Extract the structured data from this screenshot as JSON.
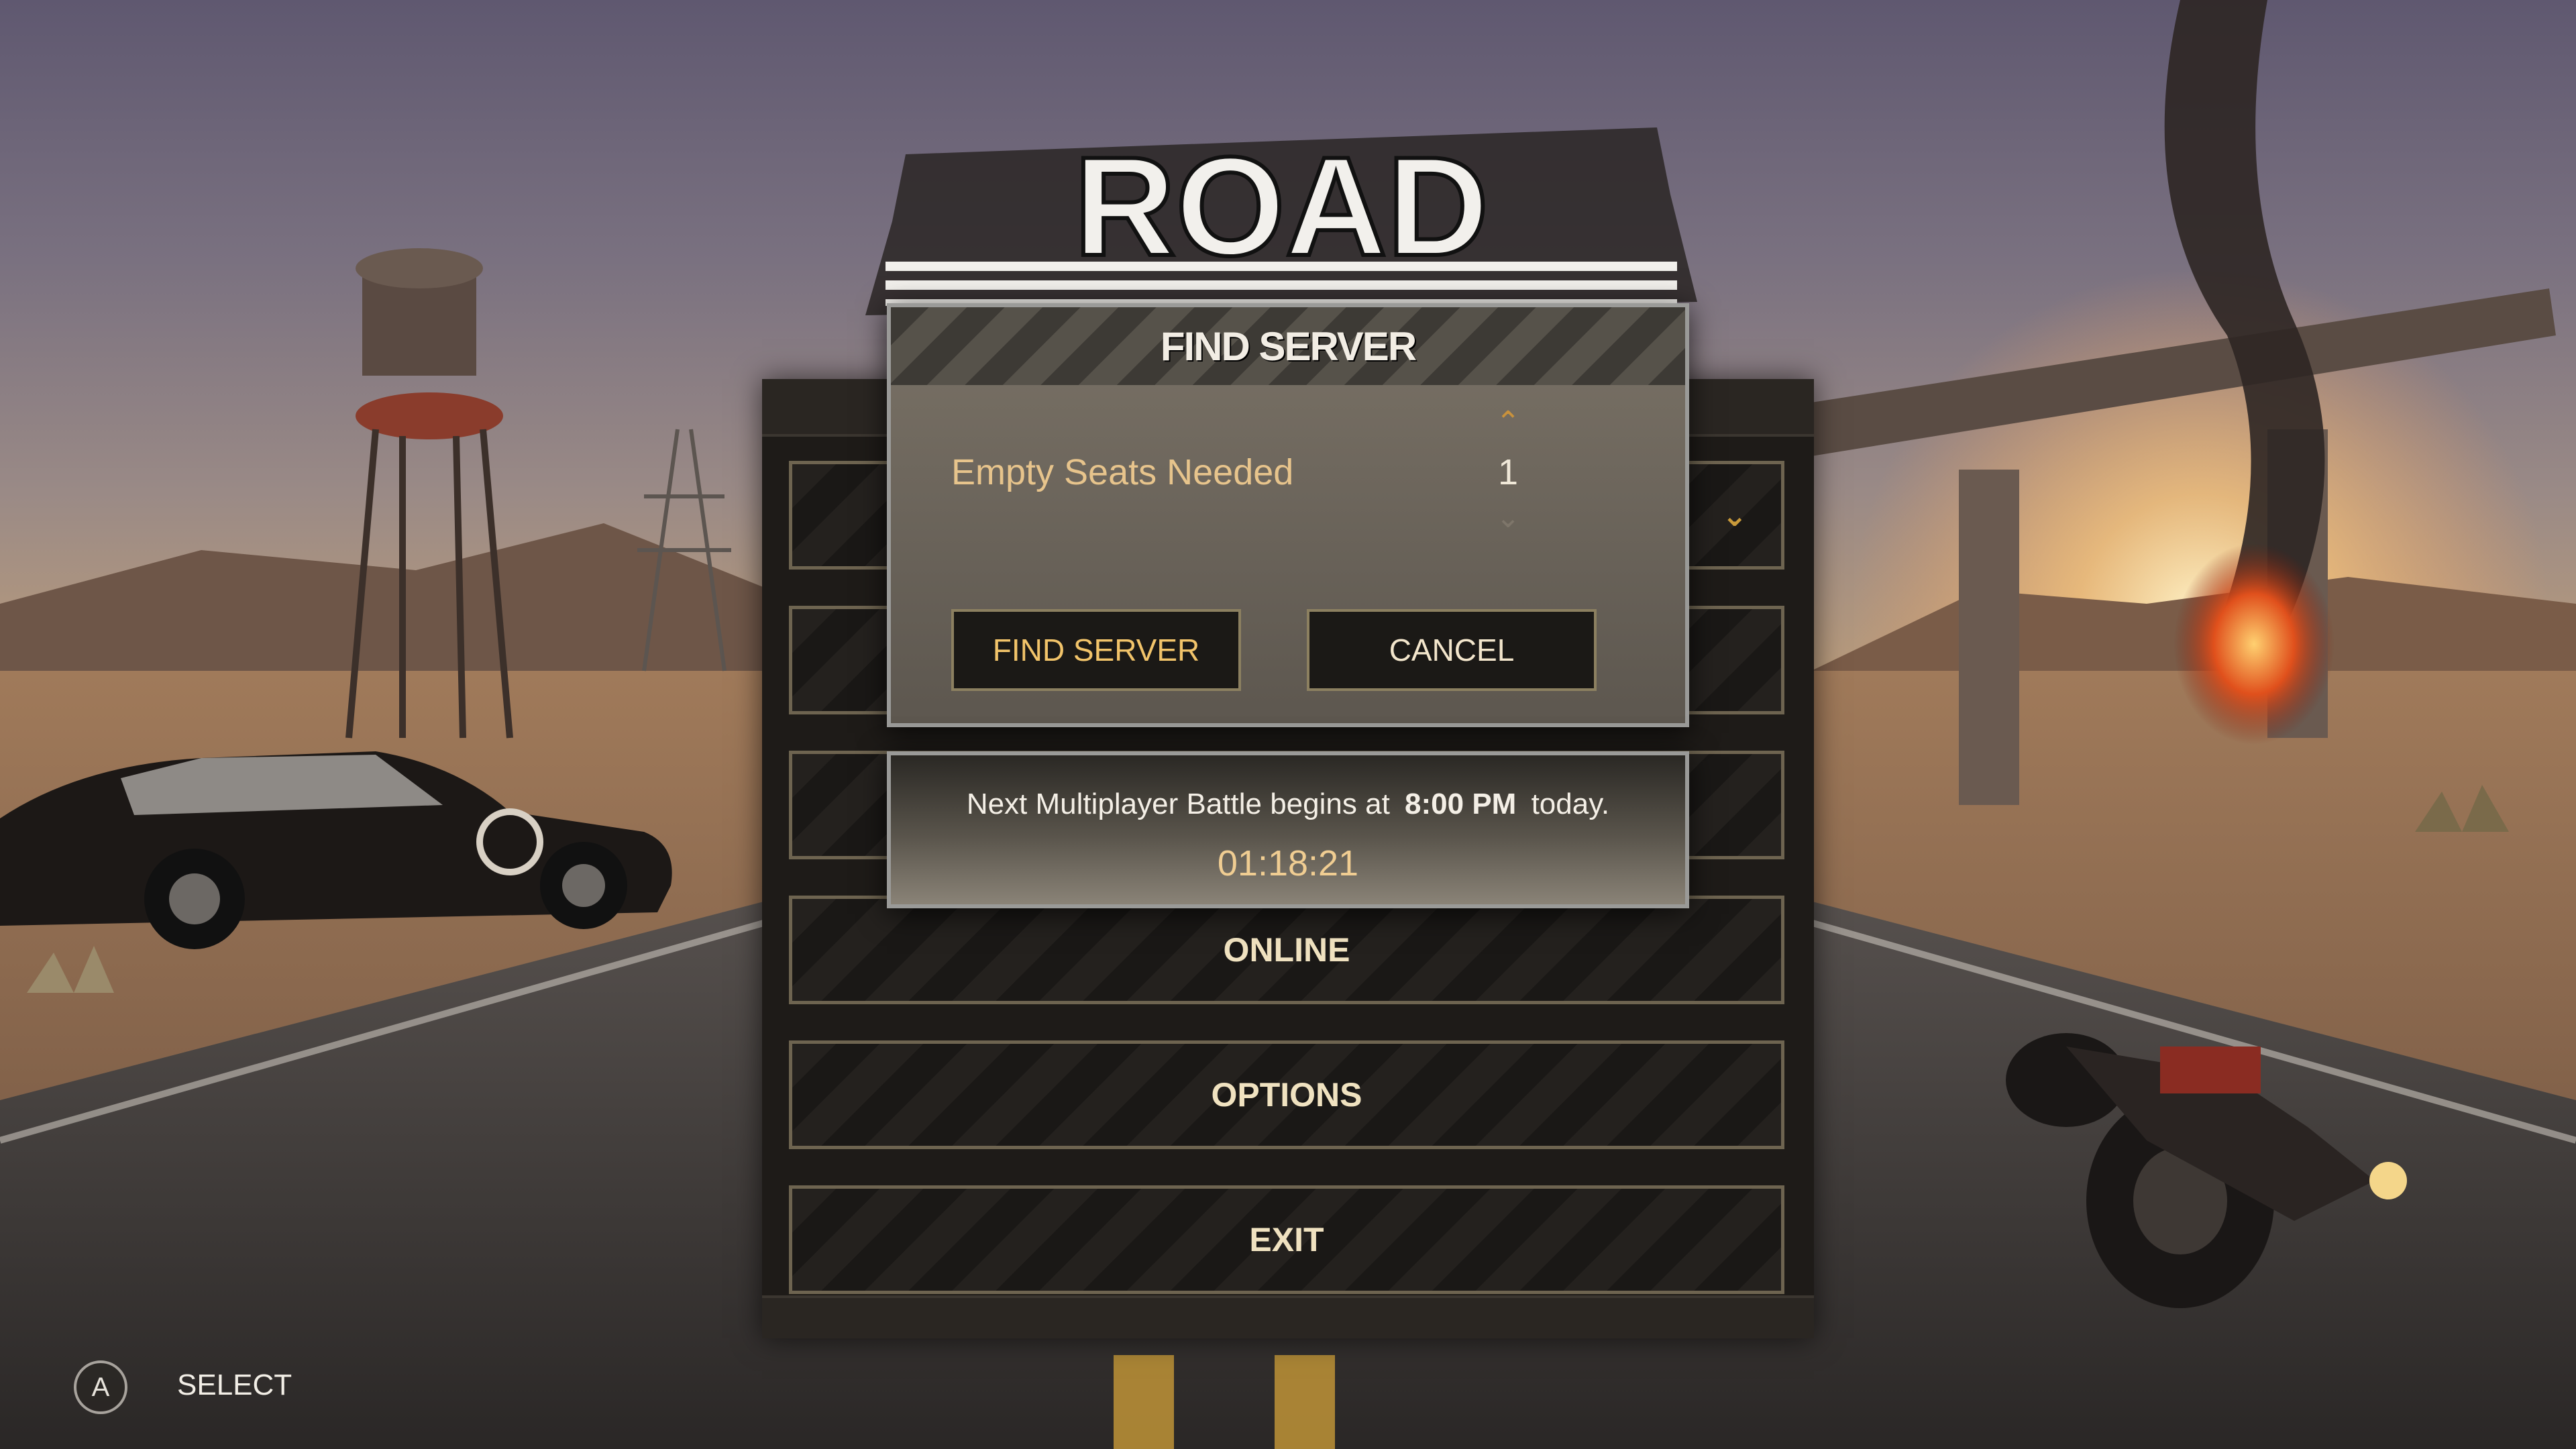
{
  "game": {
    "logo_text": "ROAD"
  },
  "main_menu": {
    "items": [
      {
        "label": ""
      },
      {
        "label": ""
      },
      {
        "label": ""
      },
      {
        "label": "ONLINE"
      },
      {
        "label": "OPTIONS"
      },
      {
        "label": "EXIT"
      }
    ],
    "dropdown_icon": "chevron-down-icon"
  },
  "find_server_dialog": {
    "title": "FIND SERVER",
    "seats_label": "Empty Seats Needed",
    "seats_value": "1",
    "up_icon": "chevron-up-icon",
    "down_icon": "chevron-down-icon",
    "find_button": "FIND SERVER",
    "cancel_button": "CANCEL"
  },
  "next_battle": {
    "prefix": "Next Multiplayer Battle begins at",
    "time": "8:00 PM",
    "suffix": "today.",
    "countdown": "01:18:21"
  },
  "controls": {
    "a_button": "A",
    "select_label": "SELECT"
  },
  "colors": {
    "accent_gold": "#f2c46a",
    "label_tan": "#e7c48c",
    "panel_dark": "#1e1b18"
  }
}
